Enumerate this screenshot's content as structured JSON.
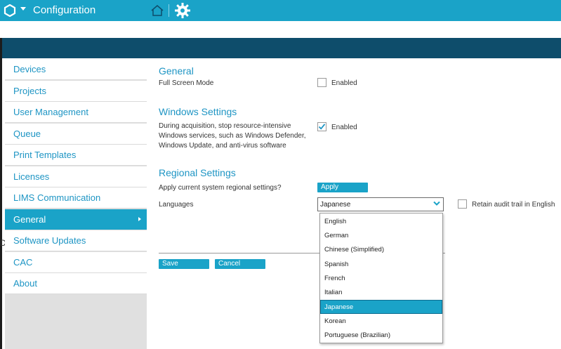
{
  "titlebar": {
    "title": "Configuration",
    "logo_icon": "hexagon-logo-icon",
    "home_icon": "home-icon",
    "settings_icon": "gear-icon",
    "color": "#1aa3c8"
  },
  "sidebar": {
    "items": [
      {
        "label": "Devices"
      },
      {
        "label": "Projects"
      },
      {
        "label": "User Management"
      },
      {
        "label": "Queue"
      },
      {
        "label": "Print Templates"
      },
      {
        "label": "Licenses"
      },
      {
        "label": "LIMS Communication"
      },
      {
        "label": "General",
        "active": true
      },
      {
        "label": "Software Updates"
      },
      {
        "label": "CAC"
      },
      {
        "label": "About"
      }
    ]
  },
  "stray_char": "D",
  "general": {
    "heading": "General",
    "full_screen_label": "Full Screen Mode",
    "full_screen_checkbox_label": "Enabled",
    "full_screen_checked": false
  },
  "windows": {
    "heading": "Windows Settings",
    "description_lines": [
      "During acquisition, stop resource-intensive",
      "Windows services, such as Windows Defender,",
      "Windows Update, and anti-virus software"
    ],
    "checkbox_label": "Enabled",
    "checked": true
  },
  "regional": {
    "heading": "Regional Settings",
    "apply_label": "Apply current system regional settings?",
    "apply_button": "Apply",
    "languages_label": "Languages",
    "selected_language": "Japanese",
    "retain_label": "Retain audit trail in English",
    "retain_checked": false,
    "options": [
      "English",
      "German",
      "Chinese (Simplified)",
      "Spanish",
      "French",
      "Italian",
      "Japanese",
      "Korean",
      "Portuguese (Brazilian)"
    ]
  },
  "actions": {
    "save": "Save",
    "cancel": "Cancel"
  }
}
